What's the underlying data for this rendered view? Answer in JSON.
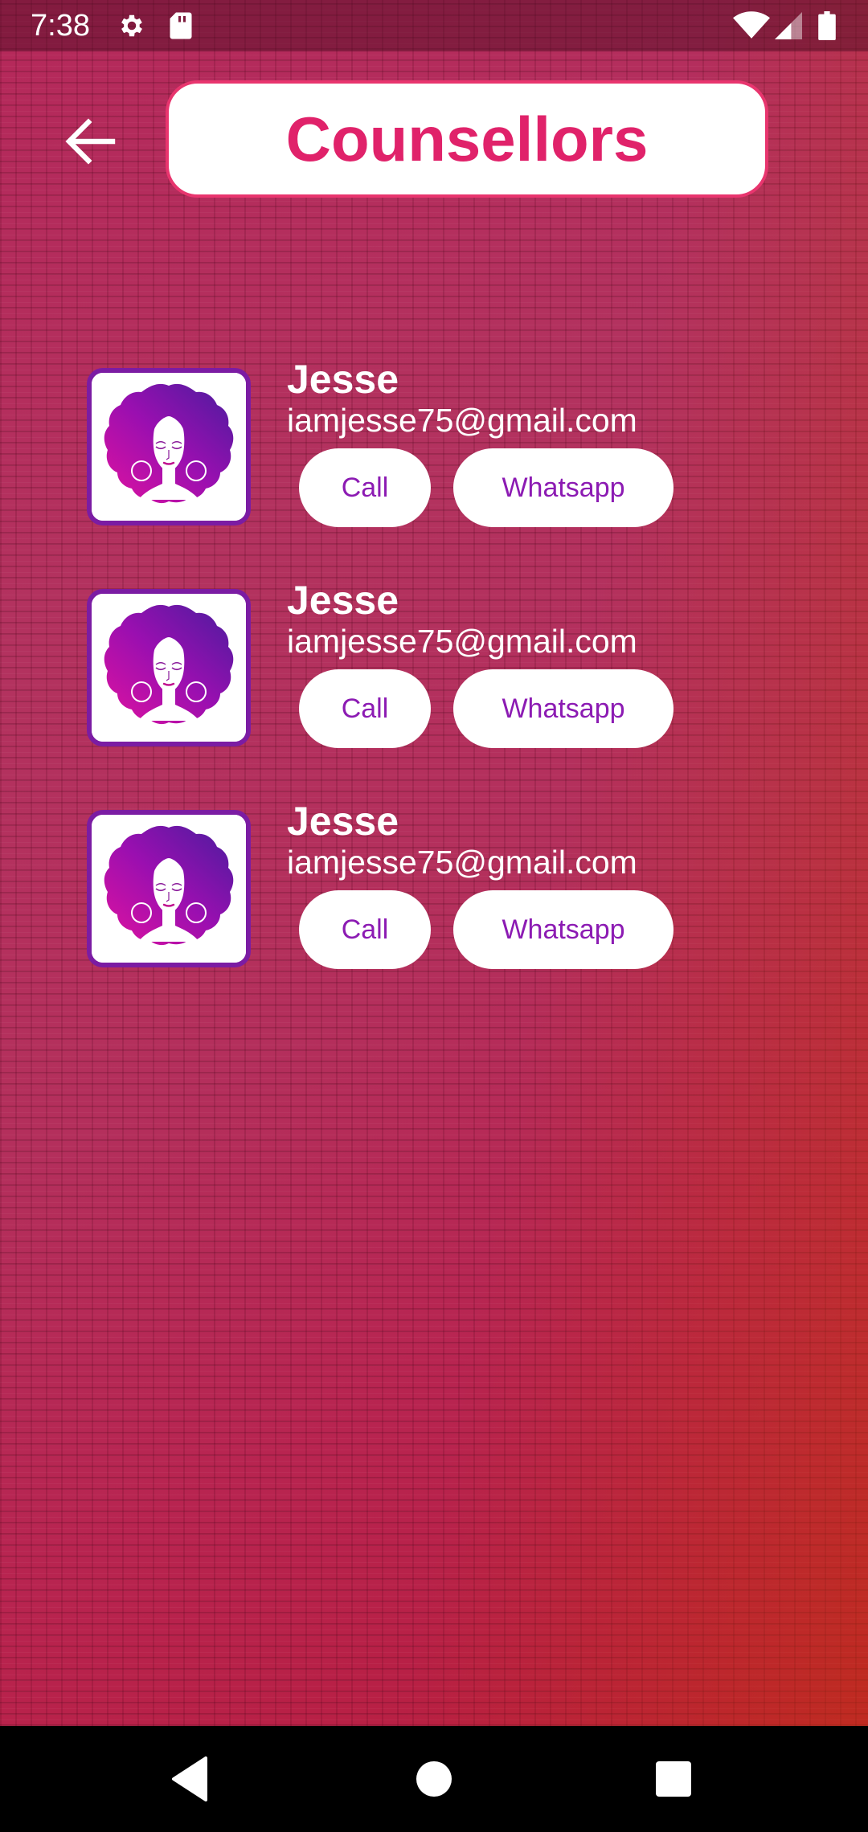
{
  "status_bar": {
    "time": "7:38",
    "icons": [
      "gear-icon",
      "sd-card-icon",
      "wifi-icon",
      "signal-icon",
      "battery-icon"
    ]
  },
  "header": {
    "back_icon": "arrow-left-icon",
    "title": "Counsellors"
  },
  "counsellors": [
    {
      "name": "Jesse",
      "email": "iamjesse75@gmail.com",
      "call_label": "Call",
      "whatsapp_label": "Whatsapp"
    },
    {
      "name": "Jesse",
      "email": "iamjesse75@gmail.com",
      "call_label": "Call",
      "whatsapp_label": "Whatsapp"
    },
    {
      "name": "Jesse",
      "email": "iamjesse75@gmail.com",
      "call_label": "Call",
      "whatsapp_label": "Whatsapp"
    }
  ],
  "nav_bar": {
    "icons": [
      "back-triangle-icon",
      "home-circle-icon",
      "recents-square-icon"
    ]
  },
  "colors": {
    "title_text": "#e0226a",
    "title_border": "#e8356e",
    "button_text": "#8c1bb3",
    "avatar_border": "#7b1ca3",
    "background": "#b3325f"
  }
}
